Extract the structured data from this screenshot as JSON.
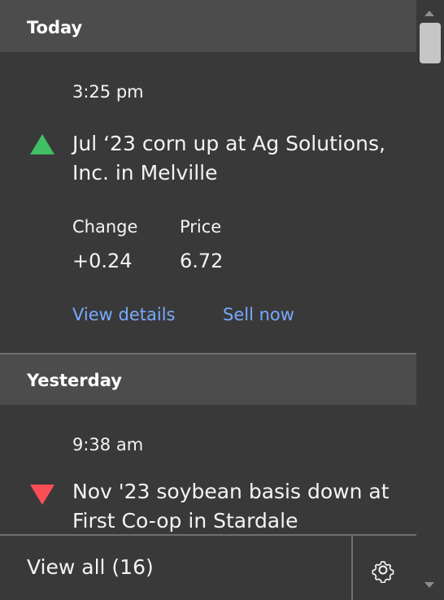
{
  "groups": [
    {
      "header": "Today",
      "notification": {
        "time": "3:25 pm",
        "direction": "up",
        "title": "Jul ‘23 corn up at Ag Solutions, Inc. in Melville",
        "change_label": "Change",
        "change_value": "+0.24",
        "price_label": "Price",
        "price_value": "6.72",
        "actions": [
          "View details",
          "Sell now"
        ]
      }
    },
    {
      "header": "Yesterday",
      "notification": {
        "time": "9:38 am",
        "direction": "down",
        "title": "Nov '23 soybean basis down at First Co-op in Stardale"
      }
    }
  ],
  "footer": {
    "view_all": "View all (16)",
    "settings_icon": "gear-icon"
  },
  "colors": {
    "background": "#393939",
    "header": "#4c4c4c",
    "up": "#42be65",
    "down": "#fa4d56",
    "link": "#78a9ff"
  }
}
